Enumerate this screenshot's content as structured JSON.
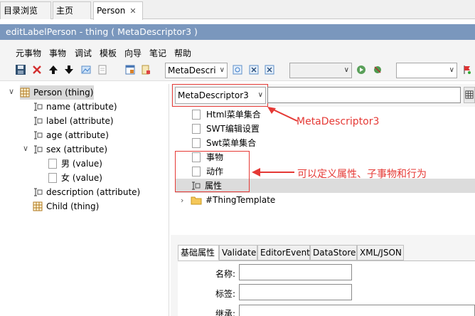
{
  "tabs": [
    {
      "label": "目录浏览",
      "active": false
    },
    {
      "label": "主页",
      "active": false
    },
    {
      "label": "Person",
      "active": true
    }
  ],
  "editor": {
    "title": "editLabelPerson - thing ( MetaDescriptor3 )"
  },
  "menu": [
    "元事物",
    "事物",
    "调试",
    "模板",
    "向导",
    "笔记",
    "帮助"
  ],
  "toolbar": {
    "descriptor_combo": "MetaDescri",
    "combo2": "",
    "combo3": ""
  },
  "tree": {
    "root": "Person (thing)",
    "children": [
      {
        "label": "name (attribute)"
      },
      {
        "label": "label (attribute)"
      },
      {
        "label": "age (attribute)"
      },
      {
        "label": "sex (attribute)",
        "children": [
          "男 (value)",
          "女 (value)"
        ]
      },
      {
        "label": "description (attribute)"
      },
      {
        "label": "Child (thing)"
      }
    ]
  },
  "descriptor": {
    "selected": "MetaDescriptor3",
    "search_value": "",
    "items": [
      "Html菜单集合",
      "SWT编辑设置",
      "Swt菜单集合",
      "事物",
      "动作",
      "属性"
    ],
    "template_node": "#ThingTemplate"
  },
  "annotations": {
    "metadescriptor": "MetaDescriptor3",
    "define": "可以定义属性、子事物和行为"
  },
  "property_tabs": [
    "基础属性",
    "Validate",
    "EditorEvent",
    "DataStore",
    "XML/JSON"
  ],
  "form": {
    "name_label": "名称:",
    "name_value": "",
    "label_label": "标签:",
    "label_value": "",
    "extends_label": "继承:",
    "extends_value": ""
  },
  "colors": {
    "titlebar": "#7a97bd",
    "annotation": "#e53935",
    "selection": "#d9d9d9"
  }
}
